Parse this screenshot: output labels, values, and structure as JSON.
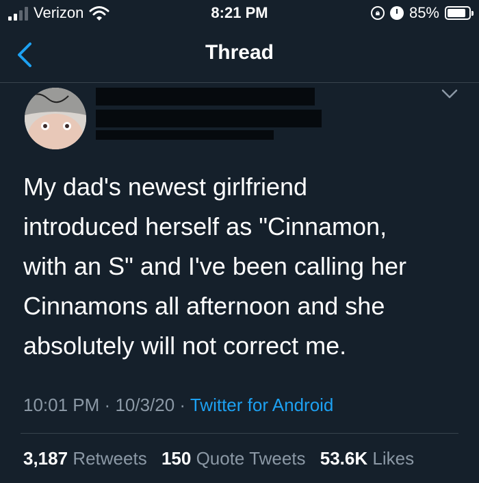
{
  "status_bar": {
    "carrier": "Verizon",
    "time": "8:21 PM",
    "battery_percent": "85%",
    "battery_level": 0.85,
    "signal_bars": 2
  },
  "nav": {
    "title": "Thread",
    "back_icon": "chevron-left-icon"
  },
  "author": {
    "display_name": "",
    "handle": "",
    "more_icon": "chevron-down-icon"
  },
  "tweet": {
    "text": "My dad's newest girlfriend\nintroduced herself as \"Cinnamon,\nwith an S\" and I've been calling her\nCinnamons all afternoon and she\nabsolutely will not correct me.",
    "time": "10:01 PM",
    "date": "10/3/20",
    "separator": "·",
    "source": "Twitter for Android"
  },
  "stats": {
    "retweets_count": "3,187",
    "retweets_label": "Retweets",
    "quotes_count": "150",
    "quotes_label": "Quote Tweets",
    "likes_count": "53.6K",
    "likes_label": "Likes"
  },
  "colors": {
    "background": "#15202b",
    "accent": "#1da1f2",
    "secondary_text": "#8b98a5",
    "divider": "#38444d"
  }
}
